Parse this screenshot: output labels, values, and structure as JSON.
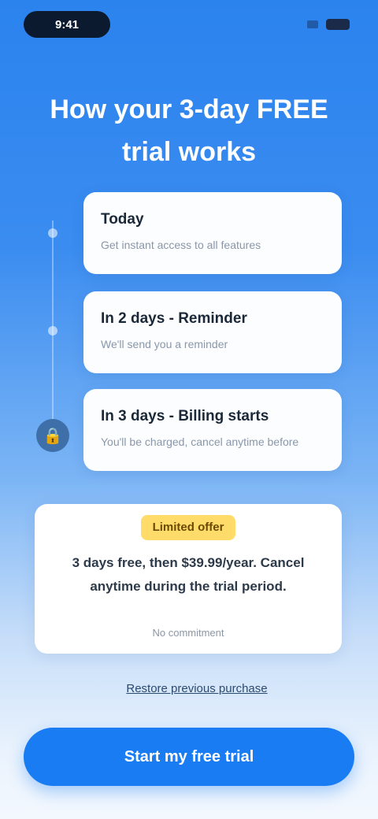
{
  "status_bar": {
    "time": "9:41"
  },
  "headline": "How your 3-day FREE trial works",
  "steps": [
    {
      "title": "Today",
      "desc": "Get instant access to all features"
    },
    {
      "title": "In 2 days - Reminder",
      "desc": "We'll send you a reminder"
    },
    {
      "title": "In 3 days - Billing starts",
      "desc": "You'll be charged, cancel anytime before"
    }
  ],
  "offer": {
    "badge": "Limited offer",
    "text": "3 days free, then $39.99/year. Cancel anytime during the trial period.",
    "fine": "No commitment"
  },
  "link": "Restore previous purchase",
  "cta": "Start my free trial",
  "colors": {
    "primary": "#1a7cf2",
    "badge": "#ffdc6a"
  },
  "icons": {
    "final_step": "lock-icon"
  }
}
